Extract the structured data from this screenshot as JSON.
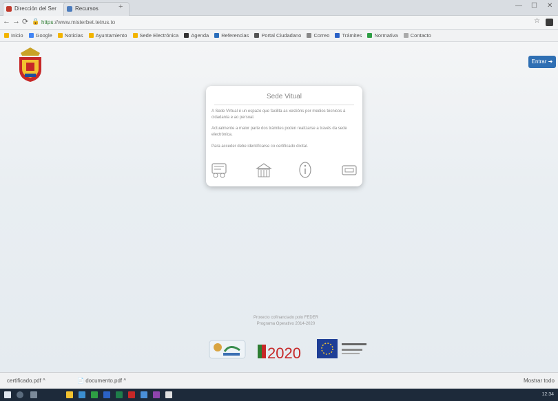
{
  "browser": {
    "tabs": [
      {
        "label": "Dirección del Ser",
        "active": true
      },
      {
        "label": "Recursos",
        "active": false
      }
    ],
    "url_scheme": "https",
    "url_rest": "://www.misterbet.tetrus.to",
    "bookmarks": [
      "Inicio",
      "Google",
      "Noticias",
      "Ayuntamiento",
      "Sede Electrónica",
      "Agenda",
      "Referencias",
      "Portal Ciudadano",
      "Correo",
      "Trámites",
      "Normativa",
      "Contacto"
    ]
  },
  "page": {
    "login_label": "Entrar",
    "card": {
      "title": "Sede Vitual",
      "p1": "A Sede Virtual é un espazo que facilita as xestións por medios técnicos á cidadanía e ao persoal.",
      "p2": "Actualmente a maior parte dos trámites poden realizarse a través da sede electrónica.",
      "p3": "Para acceder debe identificarse co certificado dixital."
    },
    "footer": {
      "line1": "Proxecto cofinanciado polo FEDER",
      "line2": "Programa Operativo 2014-2020"
    },
    "logos": {
      "campaign": "2020"
    }
  },
  "downloads": {
    "file1": "certificado.pdf",
    "file2": "documento.pdf",
    "show_all": "Mostrar todo"
  },
  "taskbar": {
    "time": "12:34"
  }
}
